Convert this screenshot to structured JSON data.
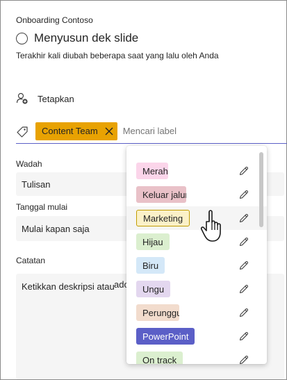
{
  "breadcrumb": "Onboarding Contoso",
  "task": {
    "title": "Menyusun dek slide",
    "modified": "Terakhir kali diubah beberapa saat yang lalu oleh Anda"
  },
  "assign": {
    "label": "Tetapkan",
    "icon": "person-add-icon"
  },
  "labels": {
    "icon": "tag-icon",
    "chip": {
      "text": "Content Team",
      "color": "#e8a202"
    },
    "search_placeholder": "Mencari label"
  },
  "bucket": {
    "label": "Wadah",
    "value": "Tulisan"
  },
  "start_date": {
    "label": "Tanggal mulai",
    "value": "Mulai kapan saja"
  },
  "notes": {
    "label": "Catatan",
    "placeholder": "Ketikkan deskripsi atau",
    "overflow": "ado"
  },
  "dropdown": {
    "items": [
      {
        "label": "Merah muda",
        "color": "#fbd5ea"
      },
      {
        "label": "Keluar jalur",
        "color": "#e9c1c8"
      },
      {
        "label": "Marketing",
        "color": "#fbf1c8",
        "border": "#c19c00"
      },
      {
        "label": "Hijau",
        "color": "#dbefcf"
      },
      {
        "label": "Biru",
        "color": "#d4e8f8"
      },
      {
        "label": "Ungu",
        "color": "#e3d7ef"
      },
      {
        "label": "Perunggu",
        "color": "#f2dccd"
      },
      {
        "label": "PowerPoint",
        "color": "#5b5fc7",
        "textColor": "#ffffff"
      },
      {
        "label": "On track",
        "color": "#dbefcf"
      }
    ],
    "edit_icon": "pencil-icon"
  },
  "colors": {
    "accent": "#5b5fc7",
    "chip": "#e8a202"
  }
}
